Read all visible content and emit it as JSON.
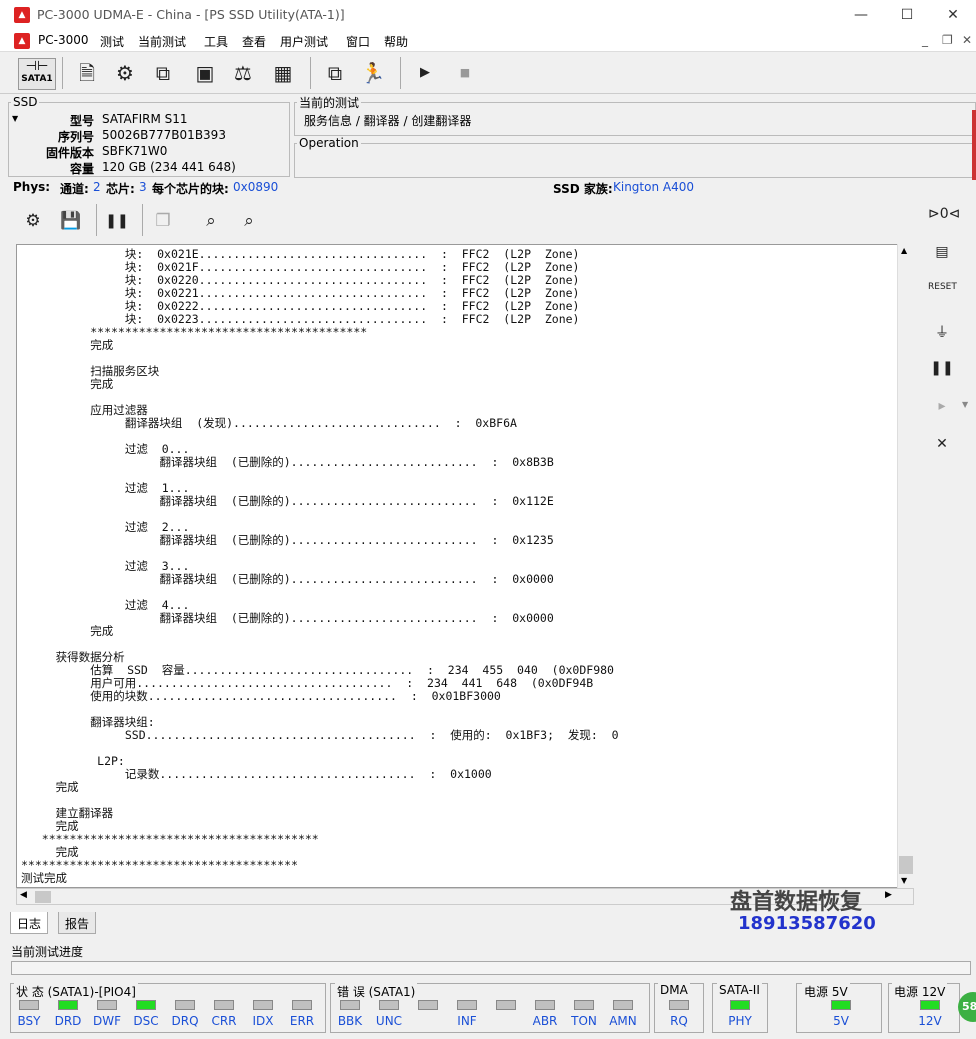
{
  "window": {
    "title": "PC-3000 UDMA-E - China - [PS SSD Utility(ATA-1)]",
    "minimize": "—",
    "maximize": "☐",
    "close": "✕"
  },
  "menu": [
    "PC-3000",
    "测试",
    "当前测试",
    "工具",
    "查看",
    "用户测试",
    "窗口",
    "帮助"
  ],
  "toolbar": {
    "sata_label": "SATA1"
  },
  "ssd": {
    "legend": "SSD",
    "model_label": "型号",
    "model": "SATAFIRM   S11",
    "serial_label": "序列号",
    "serial": "50026B777B01B393",
    "firmware_label": "固件版本",
    "firmware": "SBFK71W0",
    "capacity_label": "容量",
    "capacity": "120 GB (234 441 648)"
  },
  "current_test": {
    "legend": "当前的测试",
    "path": "服务信息 / 翻译器 / 创建翻译器"
  },
  "operation": {
    "legend": "Operation"
  },
  "phys": {
    "label": "Phys:",
    "channels_label": "通道:",
    "channels": "2",
    "chips_label": "芯片:",
    "chips": "3",
    "blocks_label": "每个芯片的块:",
    "blocks": "0x0890",
    "family_label": "SSD 家族:",
    "family": "Kington A400"
  },
  "log_lines": [
    "               块:  0x021E.................................  :  FFC2  (L2P  Zone)",
    "               块:  0x021F.................................  :  FFC2  (L2P  Zone)",
    "               块:  0x0220.................................  :  FFC2  (L2P  Zone)",
    "               块:  0x0221.................................  :  FFC2  (L2P  Zone)",
    "               块:  0x0222.................................  :  FFC2  (L2P  Zone)",
    "               块:  0x0223.................................  :  FFC2  (L2P  Zone)",
    "          ****************************************",
    "          完成",
    "",
    "          扫描服务区块",
    "          完成",
    "",
    "          应用过滤器",
    "               翻译器块组  (发现)..............................  :  0xBF6A",
    "",
    "               过滤  0...",
    "                    翻译器块组  (已删除的)...........................  :  0x8B3B",
    "",
    "               过滤  1...",
    "                    翻译器块组  (已删除的)...........................  :  0x112E",
    "",
    "               过滤  2...",
    "                    翻译器块组  (已删除的)...........................  :  0x1235",
    "",
    "               过滤  3...",
    "                    翻译器块组  (已删除的)...........................  :  0x0000",
    "",
    "               过滤  4...",
    "                    翻译器块组  (已删除的)...........................  :  0x0000",
    "          完成",
    "",
    "     获得数据分析",
    "          估算  SSD  容量.................................  :  234  455  040  (0x0DF980",
    "          用户可用.....................................  :  234  441  648  (0x0DF94B",
    "          使用的块数....................................  :  0x01BF3000",
    "",
    "          翻译器块组:",
    "               SSD.......................................  :  使用的:  0x1BF3;  发现:  0",
    "",
    "           L2P:",
    "               记录数.....................................  :  0x1000",
    "     完成",
    "",
    "     建立翻译器",
    "     完成",
    "   ****************************************",
    "     完成",
    "****************************************",
    "测试完成"
  ],
  "tabs": {
    "log": "日志",
    "report": "报告"
  },
  "progress": {
    "label": "当前测试进度"
  },
  "status_group": {
    "title": "状 态 (SATA1)-[PIO4]",
    "leds": [
      {
        "name": "BSY",
        "on": false
      },
      {
        "name": "DRD",
        "on": true
      },
      {
        "name": "DWF",
        "on": false
      },
      {
        "name": "DSC",
        "on": true
      },
      {
        "name": "DRQ",
        "on": false
      },
      {
        "name": "CRR",
        "on": false
      },
      {
        "name": "IDX",
        "on": false
      },
      {
        "name": "ERR",
        "on": false
      }
    ]
  },
  "error_group": {
    "title": "错 误 (SATA1)",
    "leds": [
      {
        "name": "BBK",
        "on": false
      },
      {
        "name": "UNC",
        "on": false
      },
      {
        "name": "",
        "on": false
      },
      {
        "name": "INF",
        "on": false
      },
      {
        "name": "",
        "on": false
      },
      {
        "name": "ABR",
        "on": false
      },
      {
        "name": "TON",
        "on": false
      },
      {
        "name": "AMN",
        "on": false
      }
    ]
  },
  "dma_group": {
    "title": "DMA",
    "led": "RQ"
  },
  "sata_group": {
    "title": "SATA-II",
    "led": "PHY"
  },
  "power5": {
    "title": "电源 5V",
    "led": "5V"
  },
  "power12": {
    "title": "电源 12V",
    "led": "12V"
  },
  "watermark": {
    "name": "盘首数据恢复",
    "phone": "18913587620"
  },
  "corner_badge": "58",
  "colors": {
    "led_on": "#22dd22",
    "led_off": "#c0c0c0",
    "accent_blue": "#1a4fd6"
  }
}
